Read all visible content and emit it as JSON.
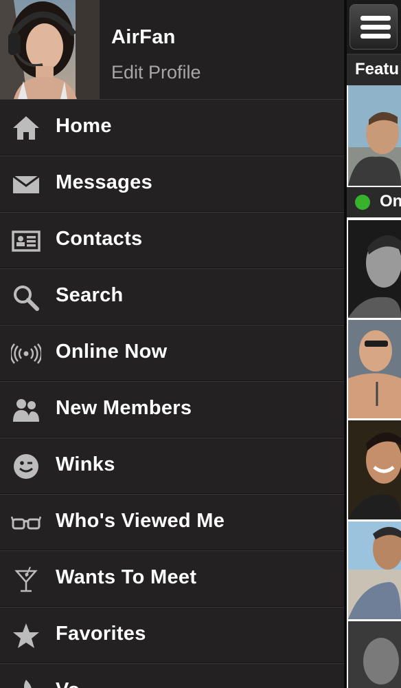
{
  "profile": {
    "username": "AirFan",
    "edit_label": "Edit Profile"
  },
  "menu": {
    "items": [
      {
        "label": "Home",
        "icon": "home-icon"
      },
      {
        "label": "Messages",
        "icon": "envelope-icon"
      },
      {
        "label": "Contacts",
        "icon": "contact-card-icon"
      },
      {
        "label": "Search",
        "icon": "search-icon"
      },
      {
        "label": "Online Now",
        "icon": "broadcast-icon"
      },
      {
        "label": "New Members",
        "icon": "people-icon"
      },
      {
        "label": "Winks",
        "icon": "wink-face-icon"
      },
      {
        "label": "Who's Viewed Me",
        "icon": "glasses-icon"
      },
      {
        "label": "Wants To Meet",
        "icon": "cocktail-icon"
      },
      {
        "label": "Favorites",
        "icon": "star-icon"
      },
      {
        "label": "Vo...",
        "icon": "flame-icon"
      }
    ]
  },
  "content": {
    "featured_label": "Featu",
    "online_label": "On",
    "online_dot_color": "#38b12d"
  },
  "colors": {
    "menu_bg": "#232122",
    "text": "#ffffff",
    "subtext": "#a8a6a7",
    "icon": "#bdbcbd"
  }
}
